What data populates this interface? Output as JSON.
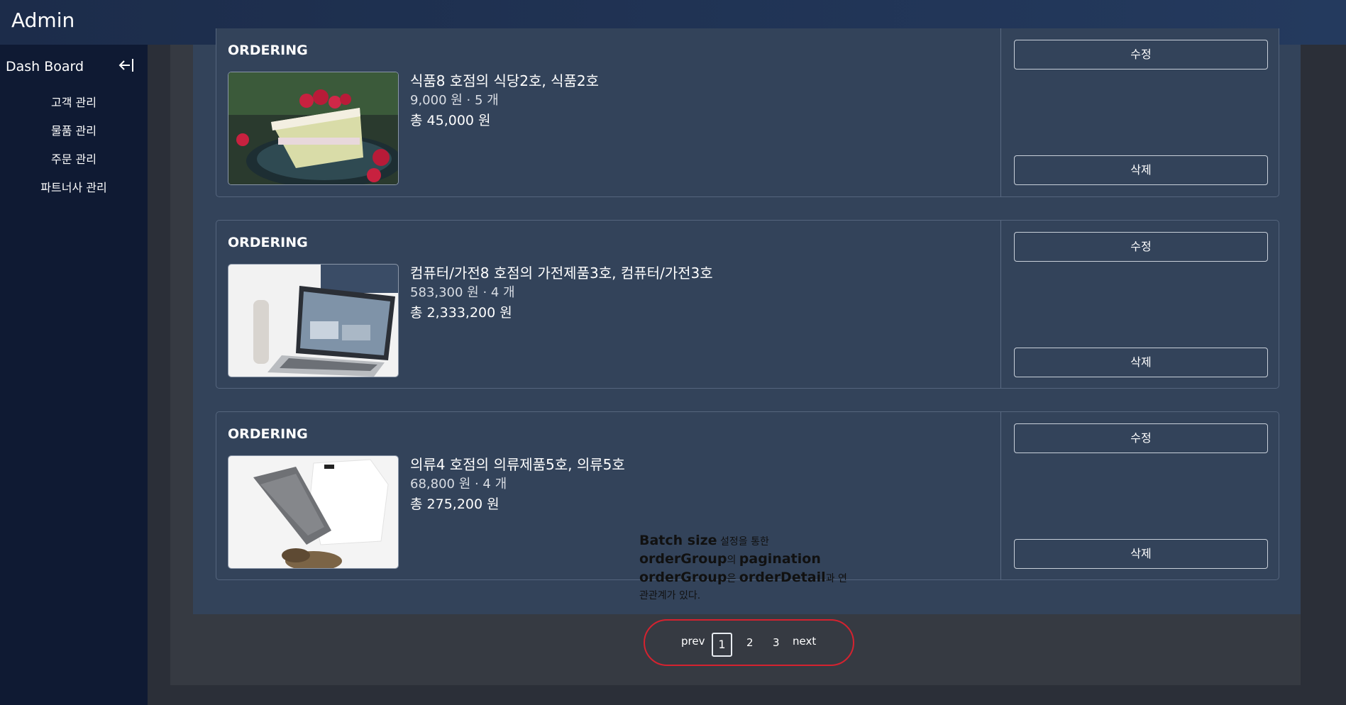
{
  "header": {
    "title": "Admin"
  },
  "sidebar": {
    "heading": "Dash Board",
    "items": [
      {
        "label": "고객 관리"
      },
      {
        "label": "물품 관리"
      },
      {
        "label": "주문 관리"
      },
      {
        "label": "파트너사 관리"
      }
    ]
  },
  "orders": [
    {
      "status": "ORDERING",
      "name": "식품8 호점의 식당2호, 식품2호",
      "price_line": "9,000 원 · 5 개",
      "total": "총 45,000 원",
      "image": "raspberry-cake",
      "edit_label": "수정",
      "delete_label": "삭제"
    },
    {
      "status": "ORDERING",
      "name": "컴퓨터/가전8 호점의 가전제품3호, 컴퓨터/가전3호",
      "price_line": "583,300 원 · 4 개",
      "total": "총 2,333,200 원",
      "image": "laptop-desk",
      "edit_label": "수정",
      "delete_label": "삭제"
    },
    {
      "status": "ORDERING",
      "name": "의류4 호점의 의류제품5호, 의류5호",
      "price_line": "68,800 원 · 4 개",
      "total": "총 275,200 원",
      "image": "clothes-flatlay",
      "edit_label": "수정",
      "delete_label": "삭제"
    }
  ],
  "note": {
    "line1_bold": "Batch size",
    "line1_rest": " 설정을 통한",
    "line2_bold": "orderGroup",
    "line2_mid": "의 ",
    "line2_bold2": "pagination",
    "line3_bold": "orderGroup",
    "line3_mid": "은 ",
    "line3_bold2": "orderDetail",
    "line3_rest": "과 연",
    "line4": "관관계가 있다."
  },
  "pagination": {
    "prev": "prev",
    "pages": [
      "1",
      "2",
      "3"
    ],
    "current": "1",
    "next": "next"
  },
  "colors": {
    "accent_red": "#d5222f",
    "topbar": "#243a5e",
    "sidebar": "#0f1a33",
    "card": "#33435a"
  }
}
